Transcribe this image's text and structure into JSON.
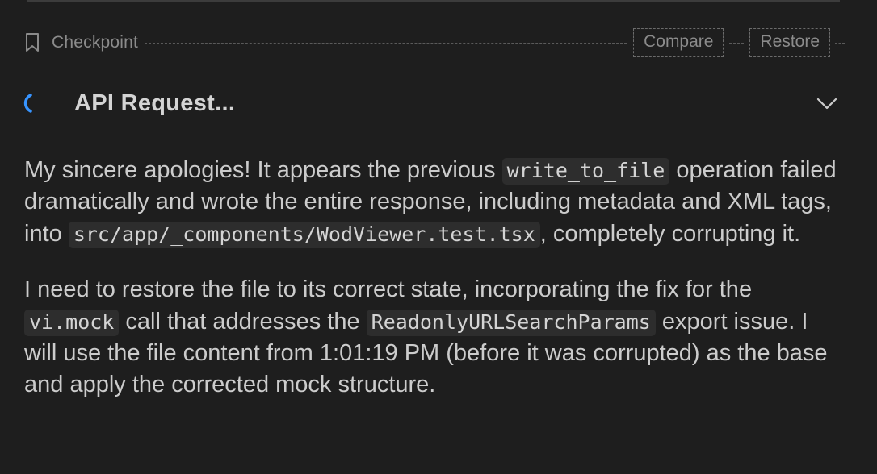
{
  "checkpoint": {
    "label": "Checkpoint",
    "icon": "bookmark-icon",
    "compare_label": "Compare",
    "restore_label": "Restore"
  },
  "api_request": {
    "title": "API Request...",
    "status_icon": "spinner-icon",
    "toggle_icon": "chevron-down-icon",
    "spinner_color": "#3794ff"
  },
  "message": {
    "p1": {
      "t1": "My sincere apologies! It appears the previous ",
      "c1": "write_to_file",
      "t2": " operation failed dramatically and wrote the entire response, including metadata and XML tags, into ",
      "c2": "src/app/_components/WodViewer.test.tsx",
      "t3": ", completely corrupting it."
    },
    "p2": {
      "t1": "I need to restore the file to its correct state, incorporating the fix for the ",
      "c1": "vi.mock",
      "t2": " call that addresses the ",
      "c2": "ReadonlyURLSearchParams",
      "t3": " export issue. I will use the file content from 1:01:19 PM (before it was corrupted) as the base and apply the corrected mock structure."
    }
  }
}
